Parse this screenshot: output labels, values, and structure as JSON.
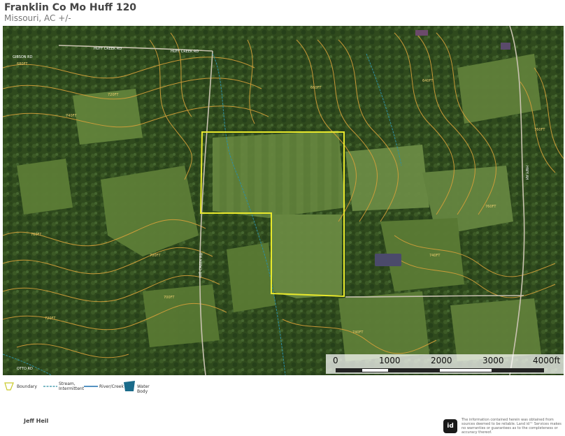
{
  "header": {
    "title": "Franklin Co Mo Huff 120",
    "subtitle": "Missouri,  AC +/-"
  },
  "map": {
    "type": "aerial-topographic",
    "contour_labels": [
      "680FT",
      "720FT",
      "740FT",
      "760FT",
      "700FT",
      "660FT",
      "640FT",
      "760FT",
      "740FT",
      "720FT",
      "700FT",
      "760FT",
      "740FT"
    ],
    "road_labels": [
      "GIBSON RD",
      "HUFF CREEK RD",
      "HUFF CREEK RD",
      "LYE CREEK RD",
      "HWY AH",
      "OTTO RD"
    ],
    "colors": {
      "boundary": "#e8e82c",
      "contour": "#d9a13a",
      "stream": "#2e8fa3",
      "river": "#1c6fae",
      "water_body": "#1a6b8a"
    }
  },
  "scale_bar": {
    "labels": [
      "0",
      "1000",
      "2000",
      "3000",
      "4000ft"
    ]
  },
  "legend": {
    "items": [
      {
        "label": "Boundary",
        "icon": "boundary-icon"
      },
      {
        "label": "Stream,\nIntermittent",
        "icon": "stream-icon"
      },
      {
        "label": "River/Creek",
        "icon": "river-icon"
      },
      {
        "label": "Water Body",
        "icon": "water-body-icon"
      }
    ]
  },
  "footer": {
    "author": "Jeff Heil",
    "logo_text": "id",
    "disclaimer": "The information contained herein was obtained from sources deemed to be reliable. Land id™ Services makes no warranties or guarantees as to the completeness or accuracy thereof."
  }
}
